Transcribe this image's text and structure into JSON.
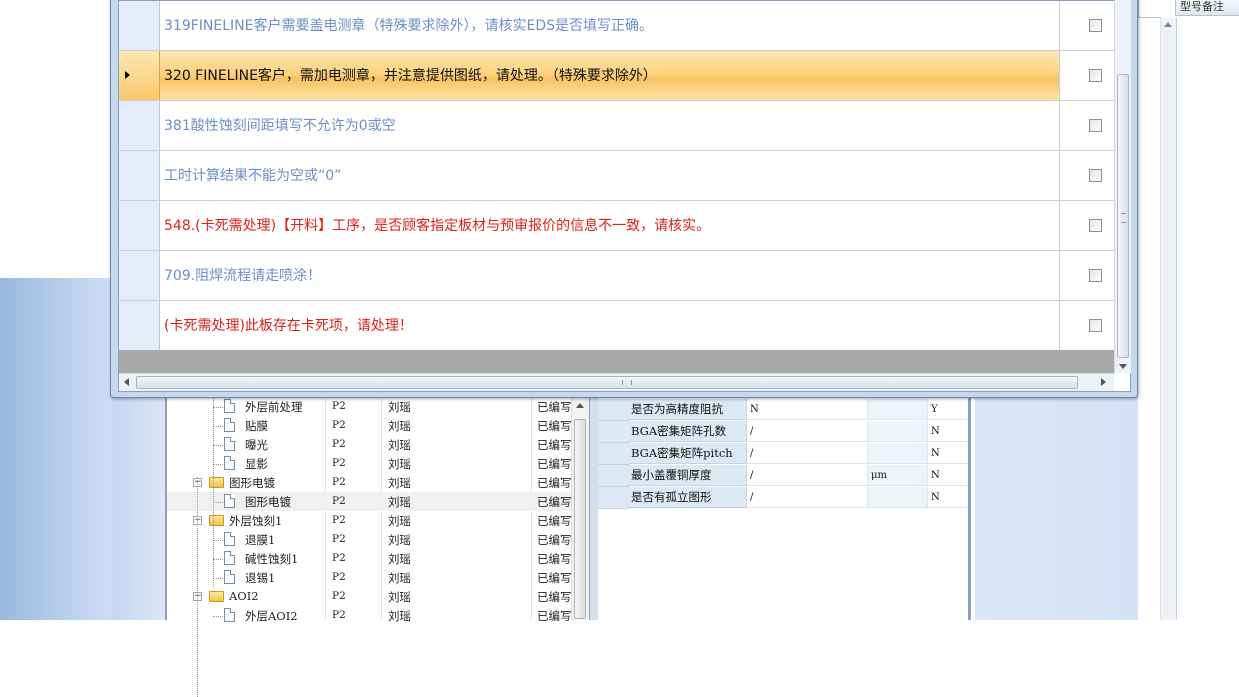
{
  "right_panel": {
    "header": "型号备注"
  },
  "messages": [
    {
      "text": "319FINELINE客户需要盖电测章（特殊要求除外），请核实EDS是否填写正确。",
      "color": "#6b8fc7",
      "selected": false
    },
    {
      "text": "320 FINELINE客户，需加电测章，并注意提供图纸，请处理。（特殊要求除外）",
      "color": "#111111",
      "selected": true
    },
    {
      "text": "381酸性蚀刻间距填写不允许为0或空",
      "color": "#6b8fc7",
      "selected": false
    },
    {
      "text": "工时计算结果不能为空或“0”",
      "color": "#6b8fc7",
      "selected": false
    },
    {
      "text": "548.(卡死需处理)【开料】工序，是否顾客指定板材与预审报价的信息不一致，请核实。",
      "color": "#e0201b",
      "selected": false
    },
    {
      "text": "709.阻焊流程请走喷涂！",
      "color": "#6b8fc7",
      "selected": false
    },
    {
      "text": "(卡死需处理)此板存在卡死项，请处理！",
      "color": "#e0201b",
      "selected": false
    }
  ],
  "tree": {
    "rows": [
      {
        "name": "外层前处理",
        "level": 2,
        "icon": "file-icon",
        "code": "P2",
        "user": "刘瑶",
        "status": "已编写"
      },
      {
        "name": "贴膜",
        "level": 2,
        "icon": "file-icon",
        "code": "P2",
        "user": "刘瑶",
        "status": "已编写"
      },
      {
        "name": "曝光",
        "level": 2,
        "icon": "file-icon",
        "code": "P2",
        "user": "刘瑶",
        "status": "已编写"
      },
      {
        "name": "显影",
        "level": 2,
        "icon": "file-icon",
        "code": "P2",
        "user": "刘瑶",
        "status": "已编写"
      },
      {
        "name": "图形电镀",
        "level": 1,
        "icon": "folder-icon",
        "code": "P2",
        "user": "刘瑶",
        "status": "已编写"
      },
      {
        "name": "图形电镀",
        "level": 2,
        "icon": "file-icon",
        "code": "P2",
        "user": "刘瑶",
        "status": "已编写",
        "selected": true
      },
      {
        "name": "外层蚀刻1",
        "level": 1,
        "icon": "folder-icon",
        "code": "P2",
        "user": "刘瑶",
        "status": "已编写"
      },
      {
        "name": "退膜1",
        "level": 2,
        "icon": "file-icon",
        "code": "P2",
        "user": "刘瑶",
        "status": "已编写"
      },
      {
        "name": "碱性蚀刻1",
        "level": 2,
        "icon": "file-icon",
        "code": "P2",
        "user": "刘瑶",
        "status": "已编写"
      },
      {
        "name": "退锡1",
        "level": 2,
        "icon": "file-icon",
        "code": "P2",
        "user": "刘瑶",
        "status": "已编写"
      },
      {
        "name": "AOI2",
        "level": 1,
        "icon": "folder-icon",
        "code": "P2",
        "user": "刘瑶",
        "status": "已编写"
      },
      {
        "name": "外层AOI2",
        "level": 2,
        "icon": "file-icon",
        "code": "P2",
        "user": "刘瑶",
        "status": "已编写"
      }
    ]
  },
  "properties": [
    {
      "name": "是否为高精度阻抗",
      "value": "N",
      "unit": "",
      "yn": "Y"
    },
    {
      "name": "BGA密集矩阵孔数",
      "value": "/",
      "unit": "",
      "yn": "N"
    },
    {
      "name": "BGA密集矩阵pitch",
      "value": "/",
      "unit": "",
      "yn": "N"
    },
    {
      "name": "最小盖覆铜厚度",
      "value": "/",
      "unit": "μm",
      "yn": "N"
    },
    {
      "name": "是否有孤立图形",
      "value": "/",
      "unit": "",
      "yn": "N"
    }
  ]
}
